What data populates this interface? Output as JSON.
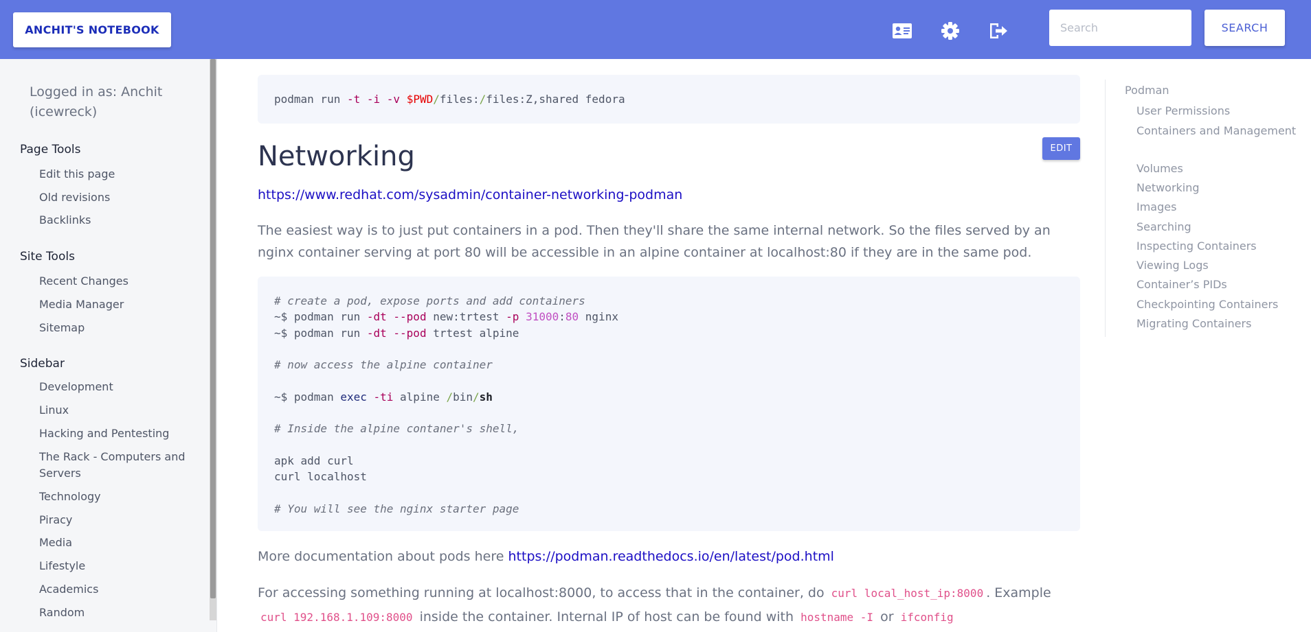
{
  "header": {
    "brand": "ANCHIT'S NOTEBOOK",
    "icons": [
      "profile-card-icon",
      "gear-icon",
      "logout-icon"
    ],
    "search_placeholder": "Search",
    "search_button": "SEARCH",
    "accent": "#6077e1"
  },
  "sidebar": {
    "logged_in": "Logged in as: Anchit (icewreck)",
    "page_tools": {
      "heading": "Page Tools",
      "items": [
        "Edit this page",
        "Old revisions",
        "Backlinks"
      ]
    },
    "site_tools": {
      "heading": "Site Tools",
      "items": [
        "Recent Changes",
        "Media Manager",
        "Sitemap"
      ]
    },
    "sidebar": {
      "heading": "Sidebar",
      "items": [
        "Development",
        "Linux",
        "Hacking and Pentesting",
        "The Rack - Computers and Servers",
        "Technology",
        "Piracy",
        "Media",
        "Lifestyle",
        "Academics",
        "Random"
      ]
    }
  },
  "main": {
    "top_code": "podman run -t -i -v $PWD/files:/files:Z,shared fedora",
    "heading": "Networking",
    "edit_label": "EDIT",
    "link1": "https://www.redhat.com/sysadmin/container-networking-podman",
    "para1": "The easiest way is to just put containers in a pod. Then they'll share the same internal network. So the files served by an nginx container serving at port 80 will be accessible in an alpine container at localhost:80 if they are in the same pod.",
    "code_lines": [
      "# create a pod, expose ports and add containers",
      "~$ podman run -dt --pod new:trtest -p 31000:80 nginx",
      "~$ podman run -dt --pod trtest alpine",
      "# now access the alpine container",
      "~$ podman exec -ti alpine /bin/sh",
      "# Inside the alpine contaner's shell,",
      "apk add curl",
      "curl localhost",
      "# You will see the nginx starter page"
    ],
    "more_doc_text": "More documentation about pods here",
    "more_doc_link": "https://podman.readthedocs.io/en/latest/pod.html",
    "para3_a": "For accessing something running at localhost:8000, to access that in the container, do",
    "para3_code1": "curl local_host_ip:8000",
    "para3_b": ". Example",
    "para3_code2": "curl 192.168.1.109:8000",
    "para3_c": "inside the container. Internal IP of host can be found with",
    "para3_code3": "hostname -I",
    "para3_d": "or",
    "para3_code4": "ifconfig"
  },
  "toc": {
    "heading": "Podman",
    "items": [
      "User Permissions",
      "Containers and Management",
      "Volumes",
      "Networking",
      "Images",
      "Searching",
      "Inspecting Containers",
      "Viewing Logs",
      "Container’s PIDs",
      "Checkpointing Containers",
      "Migrating Containers"
    ]
  }
}
